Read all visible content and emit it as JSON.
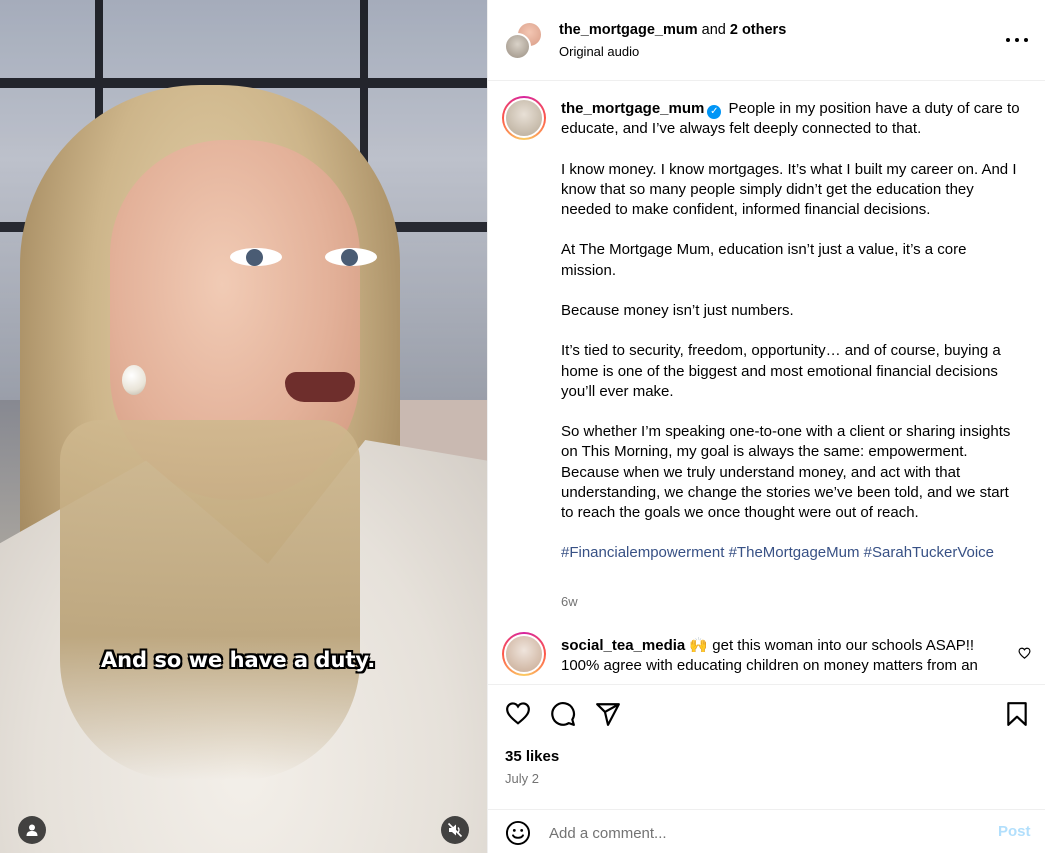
{
  "media": {
    "subtitle": "And so we have a duty."
  },
  "header": {
    "primary_user": "the_mortgage_mum",
    "and_text": "and",
    "others": "2 others",
    "audio": "Original audio"
  },
  "caption": {
    "username": "the_mortgage_mum",
    "paragraphs": [
      "People in my position have a duty of care to educate, and I’ve always felt deeply connected to that.",
      "I know money. I know mortgages. It’s what I built my career on. And I know that so many people simply didn’t get the education they needed to make confident, informed financial decisions.",
      "At The Mortgage Mum, education isn’t just a value, it’s a core mission.",
      "Because money isn’t just numbers.",
      "It’s tied to security, freedom, opportunity… and of course, buying a home is one of the biggest and most emotional financial decisions you’ll ever make.",
      "So whether I’m speaking one-to-one with a client or sharing insights on This Morning, my goal is always the same: empowerment.",
      "Because when we truly understand money, and act with that understanding, we change the stories we’ve been told, and we start to reach the goals we once thought were out of reach."
    ],
    "hashtags": [
      "#Financialempowerment",
      "#TheMortgageMum",
      "#SarahTuckerVoice"
    ],
    "time_ago": "6w"
  },
  "comments": [
    {
      "username": "social_tea_media",
      "text": "🙌 get this woman into our schools ASAP!! 100% agree with educating children on money matters from an"
    }
  ],
  "actions": {
    "likes": "35 likes",
    "date": "July 2"
  },
  "composer": {
    "placeholder": "Add a comment...",
    "post_label": "Post"
  },
  "colors": {
    "link": "#385185",
    "verified": "#0095f6",
    "post_disabled": "#b2dffc",
    "muted_text": "#737373"
  }
}
